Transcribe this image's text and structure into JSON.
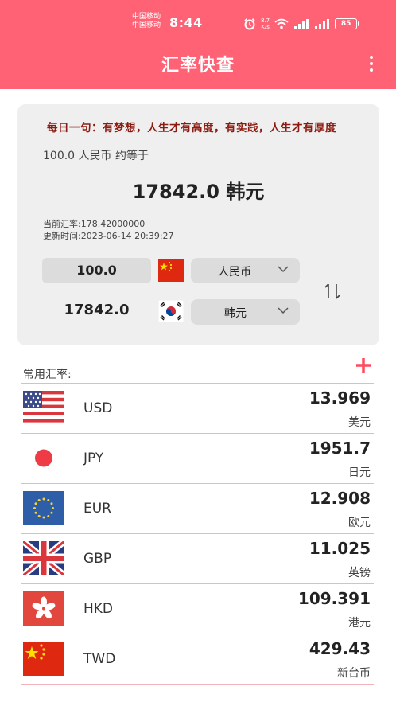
{
  "status_bar": {
    "carrier_1": "中国移动",
    "carrier_2": "中国移动",
    "time": "8:44",
    "net_speed_value": "8.7",
    "net_speed_unit": "K/s",
    "battery": "85"
  },
  "header": {
    "title": "汇率快查"
  },
  "converter": {
    "quote": "每日一句：有梦想，人生才有高度，有实践，人生才有厚度",
    "from_text": "100.0 人民币 约等于",
    "result_text": "17842.0 韩元",
    "rate_text": "当前汇率:178.42000000",
    "time_text": "更新时间:2023-06-14 20:39:27",
    "amount_value": "100.0",
    "from_currency": "人民币",
    "result_amount": "17842.0",
    "to_currency": "韩元"
  },
  "common": {
    "label": "常用汇率:",
    "rates": [
      {
        "code": "USD",
        "value": "13.969",
        "name": "美元",
        "flag": "us-flag-icon"
      },
      {
        "code": "JPY",
        "value": "1951.7",
        "name": "日元",
        "flag": "jp-flag-icon"
      },
      {
        "code": "EUR",
        "value": "12.908",
        "name": "欧元",
        "flag": "eu-flag-icon"
      },
      {
        "code": "GBP",
        "value": "11.025",
        "name": "英镑",
        "flag": "uk-flag-icon"
      },
      {
        "code": "HKD",
        "value": "109.391",
        "name": "港元",
        "flag": "hk-flag-icon"
      },
      {
        "code": "TWD",
        "value": "429.43",
        "name": "新台币",
        "flag": "tw-flag-icon"
      }
    ]
  },
  "colors": {
    "accent": "#ff6275",
    "quote": "#8c1c12",
    "card": "#efefef",
    "divider": "#f4b2bc"
  }
}
